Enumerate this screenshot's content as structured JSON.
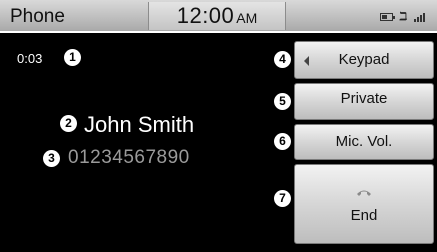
{
  "status_bar": {
    "title": "Phone",
    "time": "12:00",
    "ampm": "AM",
    "icons": [
      "battery-icon",
      "bluetooth-icon",
      "signal-icon"
    ],
    "battery_level_percent": 60
  },
  "call": {
    "duration": "0:03",
    "caller_name": "John Smith",
    "caller_number": "01234567890"
  },
  "callouts": {
    "n1": "1",
    "n2": "2",
    "n3": "3",
    "n4": "4",
    "n5": "5",
    "n6": "6",
    "n7": "7"
  },
  "buttons": {
    "keypad": "Keypad",
    "private": "Private",
    "mic_vol": "Mic. Vol.",
    "end": "End"
  },
  "colors": {
    "screen_bg": "#000000",
    "text": "#ffffff",
    "number_text": "#9a9a9a",
    "button_face": "#d6d6d6"
  }
}
